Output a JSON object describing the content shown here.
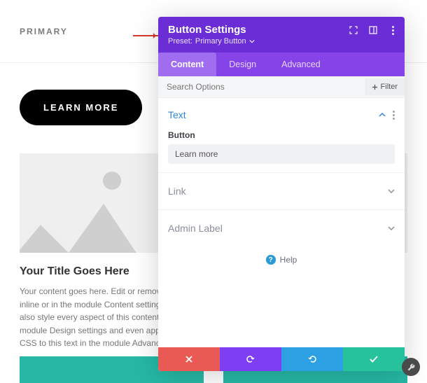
{
  "page": {
    "menu_primary": "PRIMARY",
    "learn_more_btn": "LEARN MORE",
    "card": {
      "title": "Your Title Goes Here",
      "body": "Your content goes here. Edit or remove this text inline or in the module Content settings. You can also style every aspect of this content in the module Design settings and even apply custom CSS to this text in the module Advanced settings."
    }
  },
  "panel": {
    "title": "Button Settings",
    "preset_label": "Preset:",
    "preset_value": "Primary Button",
    "tabs": {
      "content": "Content",
      "design": "Design",
      "advanced": "Advanced"
    },
    "search_placeholder": "Search Options",
    "filter_label": "Filter",
    "sections": {
      "text": "Text",
      "link": "Link",
      "admin": "Admin Label"
    },
    "fields": {
      "button_label": "Button",
      "button_value": "Learn more"
    },
    "help": "Help"
  }
}
